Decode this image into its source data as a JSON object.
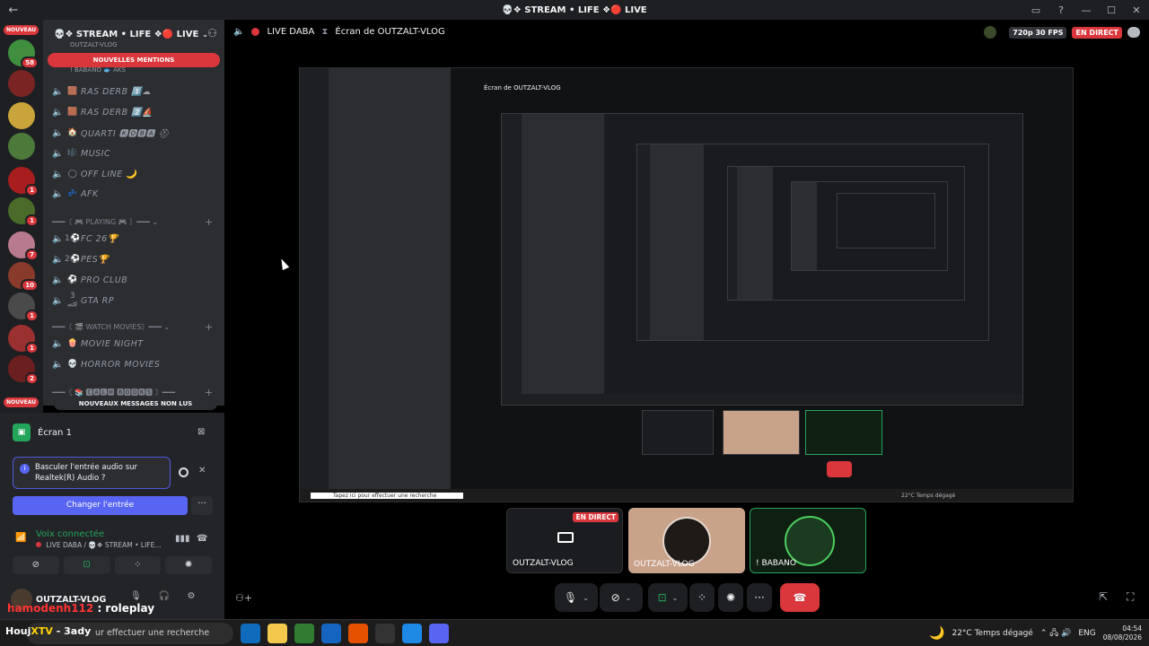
{
  "window": {
    "title": "💀❖ STREAM • LIFE ❖🔴 LIVE",
    "back": "←",
    "controls": [
      "▭",
      "?",
      "—",
      "☐",
      "✕"
    ]
  },
  "server_rail": {
    "new_badge": "NOUVEAU",
    "servers": [
      {
        "color": "#3f8f3f",
        "count": "58"
      },
      {
        "color": "#7a2424",
        "count": ""
      },
      {
        "color": "#c9a43a",
        "count": ""
      },
      {
        "color": "#4c7a3a",
        "count": ""
      },
      {
        "color": "#a81e1e",
        "count": "1"
      },
      {
        "color": "#4a6b2a",
        "count": "1"
      },
      {
        "color": "#b87a8f",
        "count": "7"
      },
      {
        "color": "#8a3a2a",
        "count": "10"
      },
      {
        "color": "#4a4a4a",
        "count": "1"
      },
      {
        "color": "#9a3030",
        "count": "1"
      },
      {
        "color": "#6b1f1f",
        "count": "2"
      }
    ]
  },
  "channels": {
    "server_name": "💀❖ STREAM • LIFE ❖🔴 LIVE",
    "mentions_banner": "NOUVELLES MENTIONS",
    "top_peek_1": "OUTZALT-VLOG",
    "top_peek_2": "! BABANO 🐟 AKS",
    "voice": [
      {
        "icon": "🟫",
        "label": "RAS DERB 1️⃣☁"
      },
      {
        "icon": "🟫",
        "label": "RAS DERB 2️⃣⛵"
      },
      {
        "icon": "🏠",
        "label": "QUARTI 🅺🅾🅱🅰 ⛑"
      },
      {
        "icon": "🎼",
        "label": "MUSIC"
      },
      {
        "icon": "◯",
        "label": "OFF LINE 🌙"
      },
      {
        "icon": "💤",
        "label": "AFK"
      }
    ],
    "cat_playing": "━━━〘 🎮 PLAYING 🎮 〙━━━ ⌄",
    "playing": [
      {
        "icon": "1⚽",
        "label": "FC 26🏆"
      },
      {
        "icon": "2⚽",
        "label": "PES🏆"
      },
      {
        "icon": "⚽",
        "label": "PRO CLUB"
      },
      {
        "icon": "3🏎",
        "label": "GTA RP"
      }
    ],
    "cat_movies": "━━━〘 🎬 WATCH MOVIES〙━━━ ⌄",
    "movies": [
      {
        "icon": "🍿",
        "label": "MOVIE NIGHT"
      },
      {
        "icon": "💀",
        "label": "HORROR MOVIES"
      }
    ],
    "cat_partial": "━━━〘 📚 🅲🅰🅻🅼 🅱🅾🅾🅺🆂 〙━━━",
    "unread_banner": "NOUVEAUX MESSAGES NON LUS",
    "new_badge": "NOUVEAU"
  },
  "panel": {
    "ecran_label": "Écran 1",
    "tip_text": "Basculer l'entrée audio sur Realtek(R) Audio ?",
    "change_button": "Changer l'entrée",
    "more": "···",
    "voice_title": "Voix connectée",
    "voice_sub": "LIVE DABA / 💀❖ STREAM • LIFE...",
    "user_name": "OUTZALT-VLOG"
  },
  "chat_overlay": {
    "nick": "hamodenh112",
    "message": ": roleplay"
  },
  "main_header": {
    "channel": "LIVE DABA",
    "screen_title": "Écran de OUTZALT-VLOG",
    "fps": "720p 30 FPS",
    "live_badge": "EN DIRECT"
  },
  "tiles": [
    {
      "label": "OUTZALT-VLOG",
      "badge": "EN DIRECT"
    },
    {
      "label": "OUTZALT-VLOG"
    },
    {
      "label": "! BABANO"
    }
  ],
  "controls": {
    "mic": "🎙",
    "cam": "⊘",
    "share": "⊡",
    "apps": "⁘",
    "fx": "✺",
    "more": "···",
    "hangup": "☎"
  },
  "taskbar": {
    "search_prefix_a": "Houj",
    "search_prefix_b": "XTV",
    "search_prefix_c": "- 3ady",
    "search_text": "ur effectuer une recherche",
    "weather": "22°C  Temps dégagé",
    "lang": "ENG",
    "time": "04:54",
    "date": "08/08/2026"
  },
  "nested": {
    "screen_title": "Écran de OUTZALT-VLOG",
    "search_text": "Tapez ici pour effectuer une recherche",
    "weather": "22°C  Temps dégagé"
  }
}
